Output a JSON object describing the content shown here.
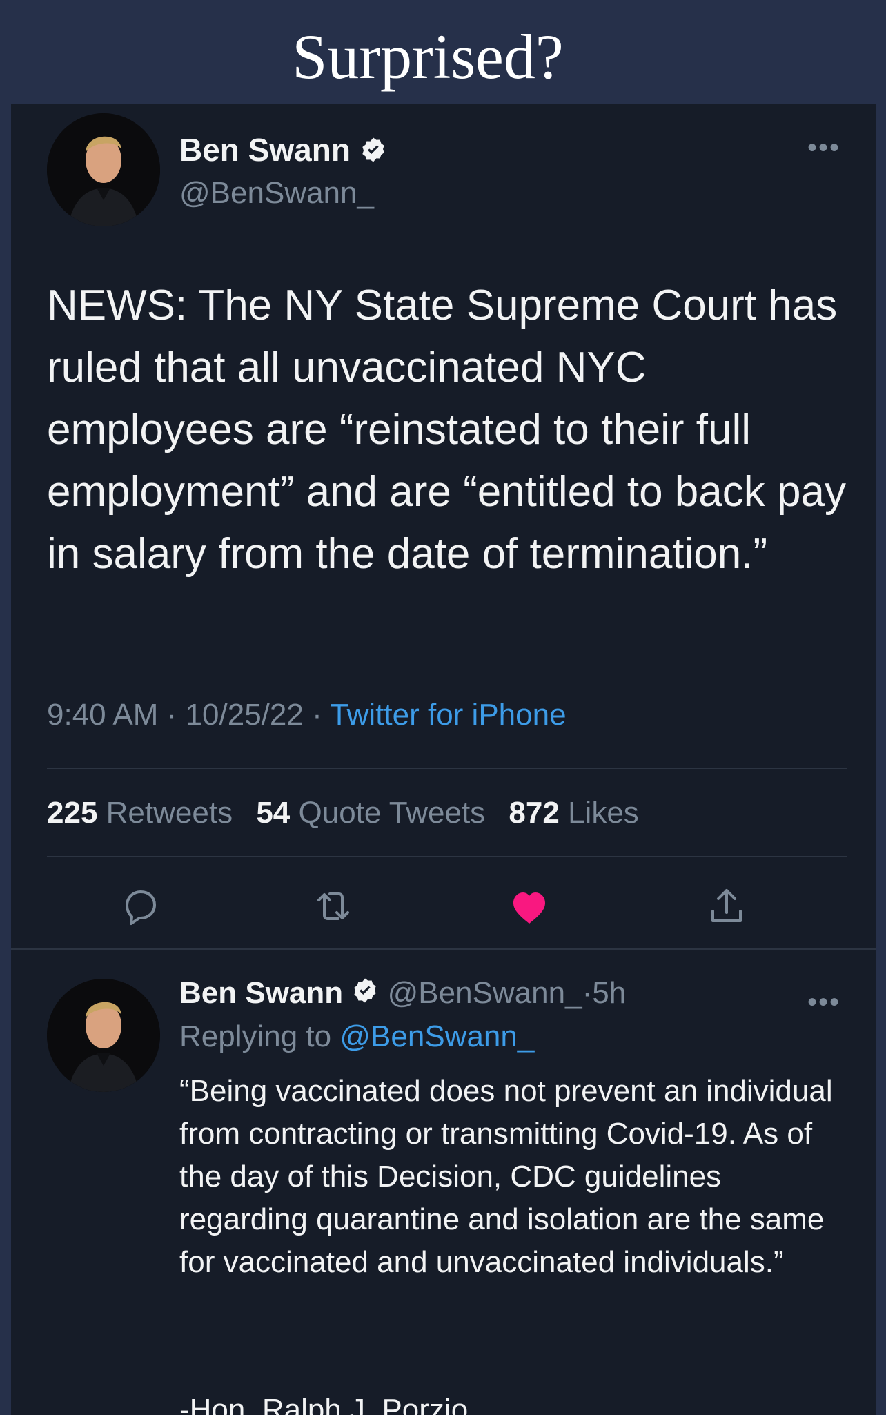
{
  "caption": "Surprised?",
  "main_tweet": {
    "author_name": "Ben Swann",
    "handle": "@BenSwann_",
    "more_icon": "more-horizontal-icon",
    "text": "NEWS: The NY State Supreme Court has ruled that all unvaccinated NYC employees are “reinstated to their full employment” and are “entitled to back pay in salary from the date of termination.”",
    "time": "9:40 AM",
    "date": "10/25/22",
    "source": "Twitter for iPhone",
    "sep": "·",
    "stats": {
      "retweets_count": "225",
      "retweets_label": "Retweets",
      "quotes_count": "54",
      "quotes_label": "Quote Tweets",
      "likes_count": "872",
      "likes_label": "Likes"
    },
    "actions": [
      "reply-icon",
      "retweet-icon",
      "heart-icon",
      "share-icon"
    ],
    "like_color": "#f91880"
  },
  "reply_tweet": {
    "author_name": "Ben Swann",
    "handle": "@BenSwann_",
    "age": "5h",
    "replying_prefix": "Replying to",
    "replying_handle": "@BenSwann_",
    "text": "“Being vaccinated does not prevent an individual from contracting or transmitting Covid-19. As of the day of this Decision, CDC guidelines regarding quarantine and isolation are the same for vaccinated and unvaccinated individuals.”",
    "signature": "-Hon. Ralph J. Porzio"
  },
  "colors": {
    "page_background": "#26304a",
    "card_background": "#161c28",
    "link": "#3d9ce8",
    "muted": "#7d8a99"
  }
}
